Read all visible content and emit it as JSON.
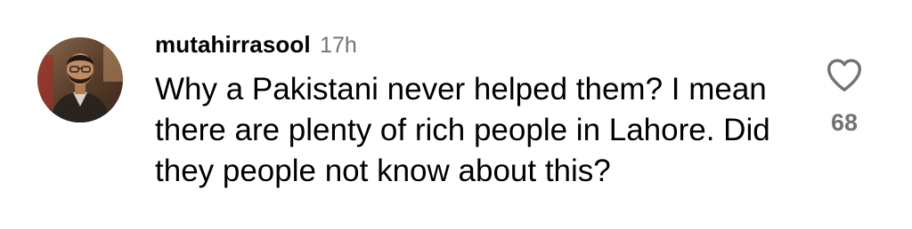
{
  "comment": {
    "username": "mutahirrasool",
    "time": "17h",
    "text": "Why a Pakistani never helped them? I mean there are plenty of rich people in Lahore. Did they people not know about this?",
    "like_count": "68",
    "avatar": "profile-photo",
    "like_icon": "heart-outline-icon"
  },
  "colors": {
    "primary_text": "#000000",
    "secondary_text": "#737373",
    "background": "#ffffff"
  }
}
